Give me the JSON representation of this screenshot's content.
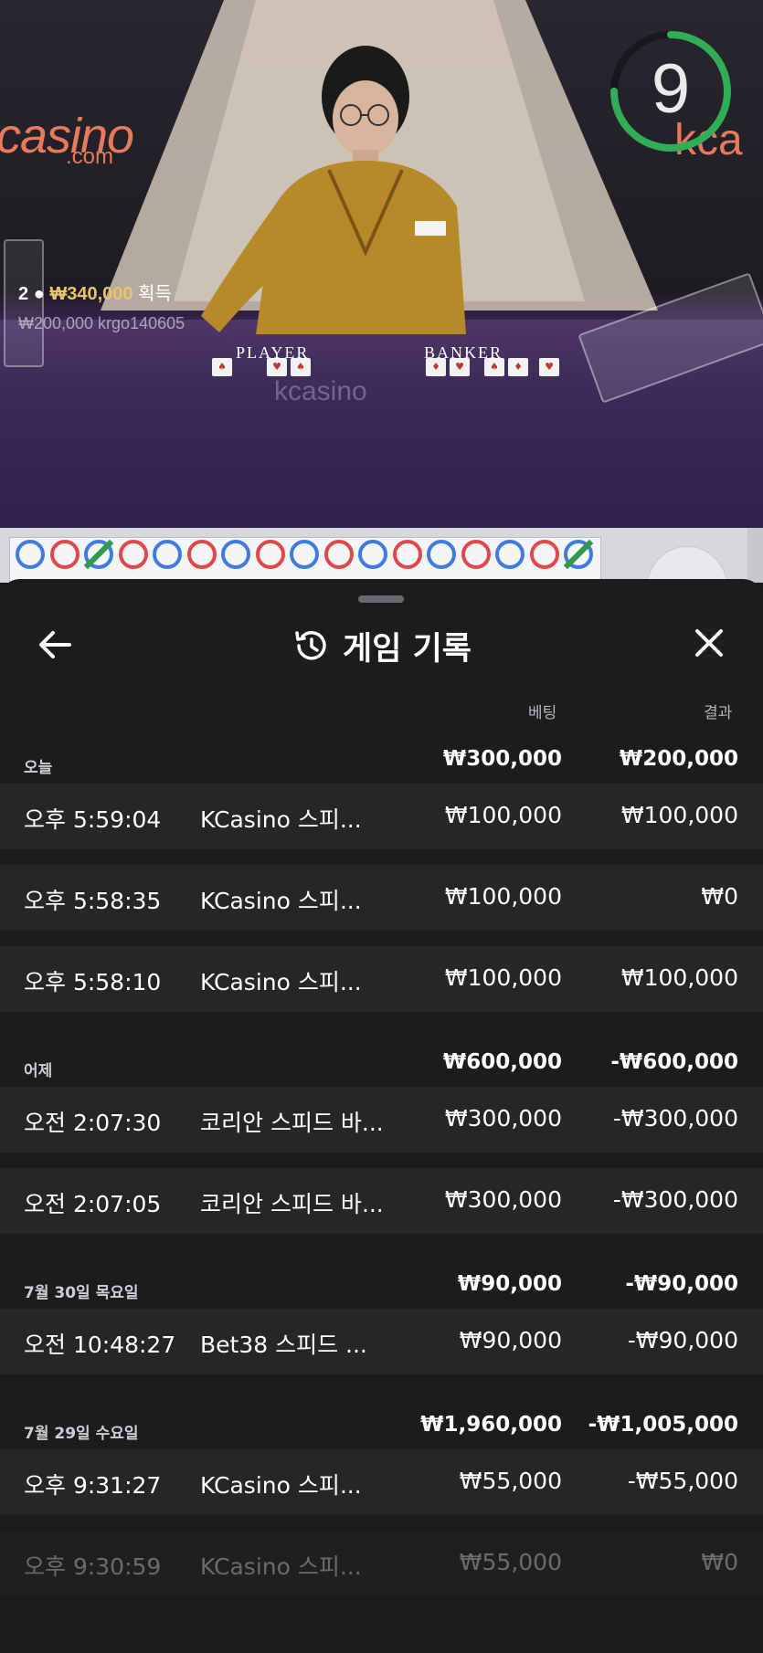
{
  "video": {
    "brand_left": "casino",
    "brand_left_sub": ".com",
    "brand_right": "kca",
    "timer_value": "9",
    "timer_fraction": 0.75,
    "win_count": "2",
    "win_amount": "₩340,000",
    "win_suffix": "획득",
    "win_line2": "₩200,000  krgo140605",
    "player_label": "PLAYER",
    "banker_label": "BANKER",
    "felt_logo": "kcasino",
    "colors": {
      "accent_gold": "#e9c46a",
      "timer_green": "#2fae57",
      "brand_orange": "#e67a5a"
    }
  },
  "roadmap": {
    "beads": [
      "P",
      "B",
      "T",
      "B",
      "P",
      "B",
      "P",
      "B",
      "P",
      "B",
      "P",
      "B",
      "P",
      "B",
      "P",
      "B",
      "T"
    ],
    "colors": {
      "player": "#3f7be0",
      "banker": "#e0484a",
      "tie": "#2f9a4a"
    }
  },
  "sheet": {
    "title": "게임 기록",
    "title_icon": "history-icon",
    "back_icon": "arrow-left-icon",
    "close_icon": "close-icon",
    "col_bet": "베팅",
    "col_result": "결과",
    "groups": [
      {
        "date": "오늘",
        "bet_total": "₩300,000",
        "result_total": "₩200,000",
        "rows": [
          {
            "time": "오후 5:59:04",
            "game": "KCasino 스피...",
            "bet": "₩100,000",
            "result": "₩100,000"
          },
          {
            "time": "오후 5:58:35",
            "game": "KCasino 스피...",
            "bet": "₩100,000",
            "result": "₩0"
          },
          {
            "time": "오후 5:58:10",
            "game": "KCasino 스피...",
            "bet": "₩100,000",
            "result": "₩100,000"
          }
        ]
      },
      {
        "date": "어제",
        "bet_total": "₩600,000",
        "result_total": "-₩600,000",
        "rows": [
          {
            "time": "오전 2:07:30",
            "game": "코리안 스피드 바...",
            "bet": "₩300,000",
            "result": "-₩300,000"
          },
          {
            "time": "오전 2:07:05",
            "game": "코리안 스피드 바...",
            "bet": "₩300,000",
            "result": "-₩300,000"
          }
        ]
      },
      {
        "date": "7월 30일 목요일",
        "bet_total": "₩90,000",
        "result_total": "-₩90,000",
        "rows": [
          {
            "time": "오전 10:48:27",
            "game": "Bet38 스피드 ...",
            "bet": "₩90,000",
            "result": "-₩90,000"
          }
        ]
      },
      {
        "date": "7월 29일 수요일",
        "bet_total": "₩1,960,000",
        "result_total": "-₩1,005,000",
        "rows": [
          {
            "time": "오후 9:31:27",
            "game": "KCasino 스피...",
            "bet": "₩55,000",
            "result": "-₩55,000"
          },
          {
            "time": "오후 9:30:59",
            "game": "KCasino 스피...",
            "bet": "₩55,000",
            "result": "₩0"
          }
        ]
      }
    ]
  }
}
